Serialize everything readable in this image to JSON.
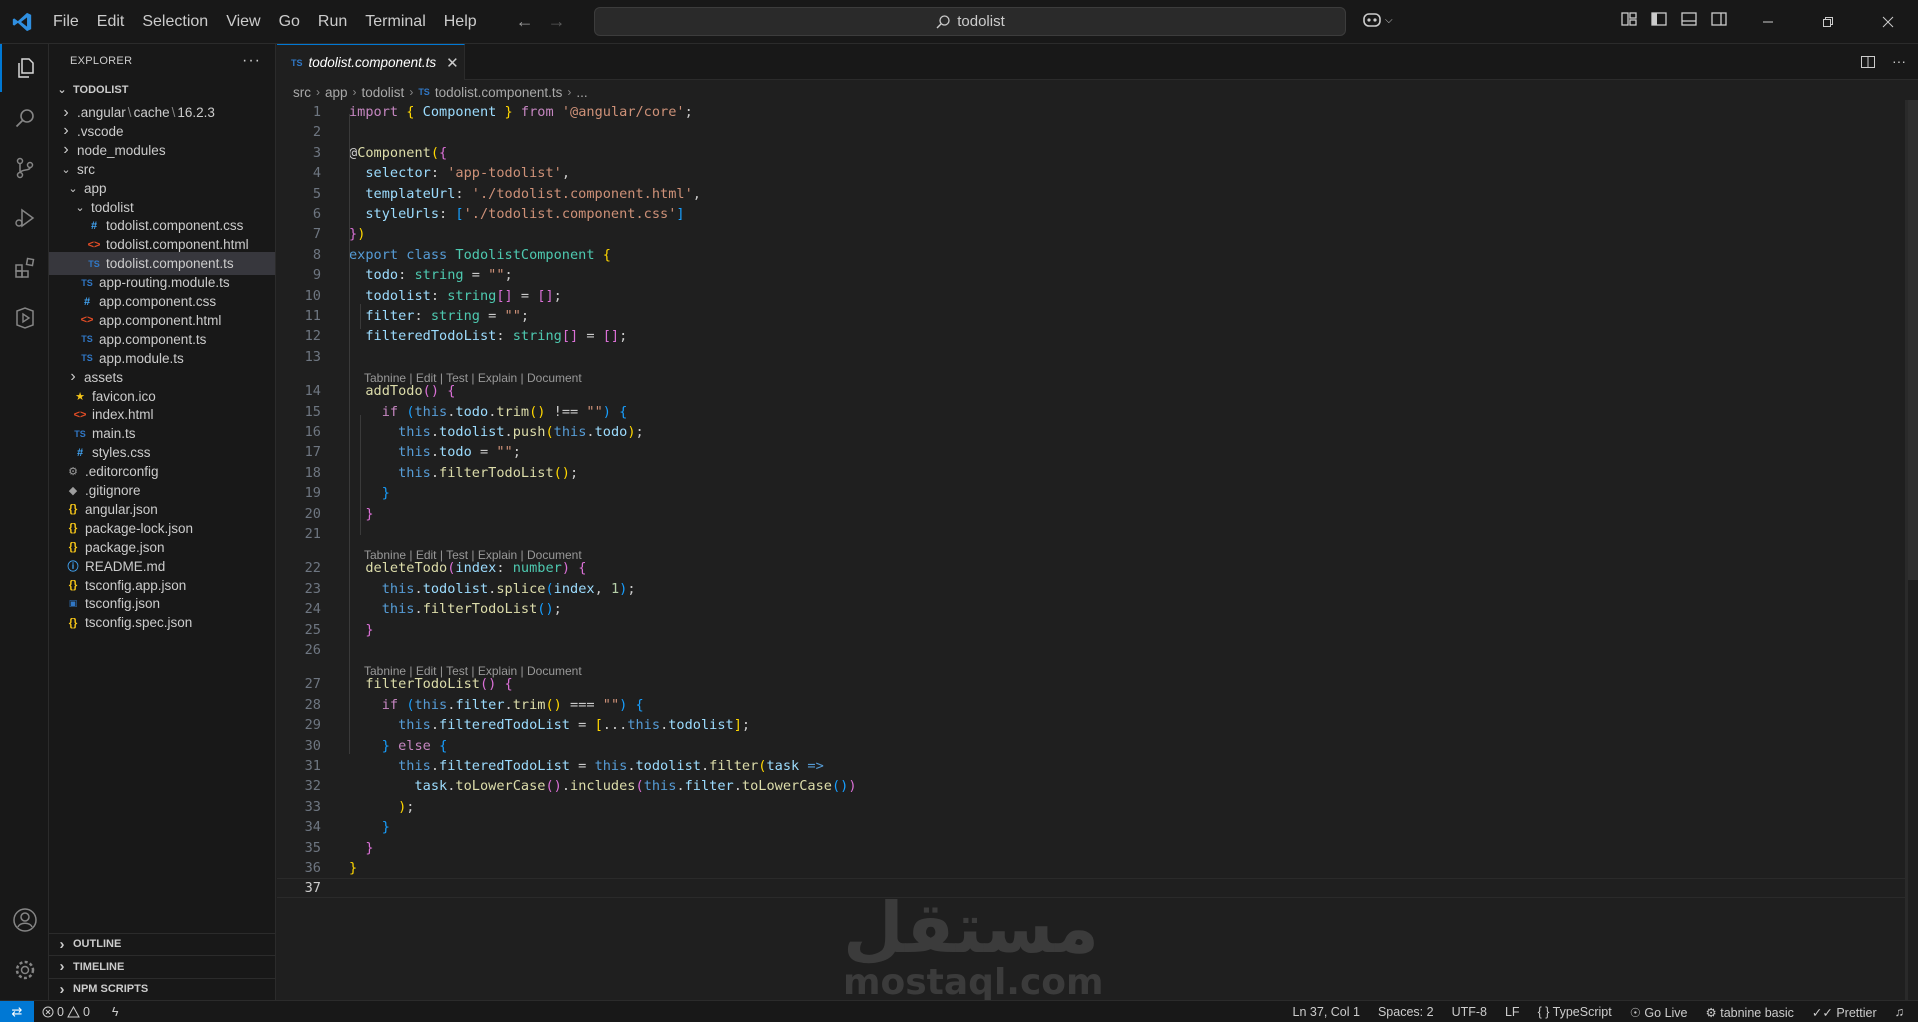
{
  "menu": [
    "File",
    "Edit",
    "Selection",
    "View",
    "Go",
    "Run",
    "Terminal",
    "Help"
  ],
  "search": {
    "text": "todolist"
  },
  "explorer": {
    "title": "EXPLORER",
    "root": "TODOLIST",
    "items": [
      {
        "label": "",
        "parts": [
          ".angular",
          "cache",
          "16.2.3"
        ],
        "depth": 0,
        "chevron": "right",
        "icon": ""
      },
      {
        "label": ".vscode",
        "depth": 0,
        "chevron": "right",
        "icon": ""
      },
      {
        "label": "node_modules",
        "depth": 0,
        "chevron": "right",
        "icon": ""
      },
      {
        "label": "src",
        "depth": 0,
        "chevron": "down",
        "icon": ""
      },
      {
        "label": "app",
        "depth": 1,
        "chevron": "down",
        "icon": ""
      },
      {
        "label": "todolist",
        "depth": 2,
        "chevron": "down",
        "icon": ""
      },
      {
        "label": "todolist.component.css",
        "depth": 3,
        "chevron": "",
        "icon": "css"
      },
      {
        "label": "todolist.component.html",
        "depth": 3,
        "chevron": "",
        "icon": "html"
      },
      {
        "label": "todolist.component.ts",
        "depth": 3,
        "chevron": "",
        "icon": "ts",
        "selected": true
      },
      {
        "label": "app-routing.module.ts",
        "depth": 2,
        "chevron": "",
        "icon": "ts"
      },
      {
        "label": "app.component.css",
        "depth": 2,
        "chevron": "",
        "icon": "css"
      },
      {
        "label": "app.component.html",
        "depth": 2,
        "chevron": "",
        "icon": "html"
      },
      {
        "label": "app.component.ts",
        "depth": 2,
        "chevron": "",
        "icon": "ts"
      },
      {
        "label": "app.module.ts",
        "depth": 2,
        "chevron": "",
        "icon": "ts"
      },
      {
        "label": "assets",
        "depth": 1,
        "chevron": "right",
        "icon": ""
      },
      {
        "label": "favicon.ico",
        "depth": 1,
        "chevron": "",
        "icon": "star"
      },
      {
        "label": "index.html",
        "depth": 1,
        "chevron": "",
        "icon": "html"
      },
      {
        "label": "main.ts",
        "depth": 1,
        "chevron": "",
        "icon": "ts"
      },
      {
        "label": "styles.css",
        "depth": 1,
        "chevron": "",
        "icon": "css"
      },
      {
        "label": ".editorconfig",
        "depth": 0,
        "chevron": "",
        "icon": "gear"
      },
      {
        "label": ".gitignore",
        "depth": 0,
        "chevron": "",
        "icon": "git"
      },
      {
        "label": "angular.json",
        "depth": 0,
        "chevron": "",
        "icon": "json"
      },
      {
        "label": "package-lock.json",
        "depth": 0,
        "chevron": "",
        "icon": "json"
      },
      {
        "label": "package.json",
        "depth": 0,
        "chevron": "",
        "icon": "json"
      },
      {
        "label": "README.md",
        "depth": 0,
        "chevron": "",
        "icon": "info"
      },
      {
        "label": "tsconfig.app.json",
        "depth": 0,
        "chevron": "",
        "icon": "json"
      },
      {
        "label": "tsconfig.json",
        "depth": 0,
        "chevron": "",
        "icon": "tsconfig"
      },
      {
        "label": "tsconfig.spec.json",
        "depth": 0,
        "chevron": "",
        "icon": "json"
      }
    ],
    "panels": [
      "OUTLINE",
      "TIMELINE",
      "NPM SCRIPTS"
    ]
  },
  "tab": {
    "label": "todolist.component.ts",
    "badge": "TS"
  },
  "breadcrumb": [
    "src",
    "app",
    "todolist",
    "todolist.component.ts",
    "..."
  ],
  "codelens": "Tabnine | Edit | Test | Explain | Document",
  "code_lines": [
    {
      "n": "1",
      "html": "<span class='k'>import</span> <span class='b1'>{</span> <span class='v'>Component</span> <span class='b1'>}</span> <span class='k'>from</span> <span class='s'>'@angular/core'</span>;"
    },
    {
      "n": "2",
      "html": ""
    },
    {
      "n": "3",
      "html": "@<span class='f'>Component</span><span class='b1'>(</span><span class='b2'>{</span>"
    },
    {
      "n": "4",
      "html": "  <span class='v'>selector</span>: <span class='s'>'app-todolist'</span>,"
    },
    {
      "n": "5",
      "html": "  <span class='v'>templateUrl</span>: <span class='s'>'./todolist.component.html'</span>,"
    },
    {
      "n": "6",
      "html": "  <span class='v'>styleUrls</span>: <span class='b3'>[</span><span class='s'>'./todolist.component.css'</span><span class='b3'>]</span>"
    },
    {
      "n": "7",
      "html": "<span class='b2'>}</span><span class='b1'>)</span>"
    },
    {
      "n": "8",
      "html": "<span class='kb'>export</span> <span class='kb'>class</span> <span class='t'>TodolistComponent</span> <span class='b1'>{</span>"
    },
    {
      "n": "9",
      "html": "  <span class='v'>todo</span>: <span class='t'>string</span> = <span class='s'>\"\"</span>;"
    },
    {
      "n": "10",
      "html": "  <span class='v'>todolist</span>: <span class='t'>string</span><span class='b2'>[]</span> = <span class='b2'>[]</span>;"
    },
    {
      "n": "11",
      "html": "  <span class='v'>filter</span>: <span class='t'>string</span> = <span class='s'>\"\"</span>;"
    },
    {
      "n": "12",
      "html": "  <span class='v'>filteredTodoList</span>: <span class='t'>string</span><span class='b2'>[]</span> = <span class='b2'>[]</span>;"
    },
    {
      "n": "13",
      "html": ""
    },
    {
      "n": "",
      "lens": true
    },
    {
      "n": "14",
      "html": "  <span class='f'>addTodo</span><span class='b2'>()</span> <span class='b2'>{</span>"
    },
    {
      "n": "15",
      "html": "    <span class='k'>if</span> <span class='b3'>(</span><span class='kb'>this</span>.<span class='v'>todo</span>.<span class='f'>trim</span><span class='b1'>()</span> !== <span class='s'>\"\"</span><span class='b3'>)</span> <span class='b3'>{</span>"
    },
    {
      "n": "16",
      "html": "      <span class='kb'>this</span>.<span class='v'>todolist</span>.<span class='f'>push</span><span class='b1'>(</span><span class='kb'>this</span>.<span class='v'>todo</span><span class='b1'>)</span>;"
    },
    {
      "n": "17",
      "html": "      <span class='kb'>this</span>.<span class='v'>todo</span> = <span class='s'>\"\"</span>;"
    },
    {
      "n": "18",
      "html": "      <span class='kb'>this</span>.<span class='f'>filterTodoList</span><span class='b1'>()</span>;"
    },
    {
      "n": "19",
      "html": "    <span class='b3'>}</span>"
    },
    {
      "n": "20",
      "html": "  <span class='b2'>}</span>"
    },
    {
      "n": "21",
      "html": ""
    },
    {
      "n": "",
      "lens": true
    },
    {
      "n": "22",
      "html": "  <span class='f'>deleteTodo</span><span class='b2'>(</span><span class='v'>index</span>: <span class='t'>number</span><span class='b2'>)</span> <span class='b2'>{</span>"
    },
    {
      "n": "23",
      "html": "    <span class='kb'>this</span>.<span class='v'>todolist</span>.<span class='f'>splice</span><span class='b3'>(</span><span class='v'>index</span>, <span class='n'>1</span><span class='b3'>)</span>;"
    },
    {
      "n": "24",
      "html": "    <span class='kb'>this</span>.<span class='f'>filterTodoList</span><span class='b3'>()</span>;"
    },
    {
      "n": "25",
      "html": "  <span class='b2'>}</span>"
    },
    {
      "n": "26",
      "html": ""
    },
    {
      "n": "",
      "lens": true
    },
    {
      "n": "27",
      "html": "  <span class='f'>filterTodoList</span><span class='b2'>()</span> <span class='b2'>{</span>"
    },
    {
      "n": "28",
      "html": "    <span class='k'>if</span> <span class='b3'>(</span><span class='kb'>this</span>.<span class='v'>filter</span>.<span class='f'>trim</span><span class='b1'>()</span> === <span class='s'>\"\"</span><span class='b3'>)</span> <span class='b3'>{</span>"
    },
    {
      "n": "29",
      "html": "      <span class='kb'>this</span>.<span class='v'>filteredTodoList</span> = <span class='b1'>[</span>...<span class='kb'>this</span>.<span class='v'>todolist</span><span class='b1'>]</span>;"
    },
    {
      "n": "30",
      "html": "    <span class='b3'>}</span> <span class='k'>else</span> <span class='b3'>{</span>"
    },
    {
      "n": "31",
      "html": "      <span class='kb'>this</span>.<span class='v'>filteredTodoList</span> = <span class='kb'>this</span>.<span class='v'>todolist</span>.<span class='f'>filter</span><span class='b1'>(</span><span class='v'>task</span> <span class='kb'>=&gt;</span>"
    },
    {
      "n": "32",
      "html": "        <span class='v'>task</span>.<span class='f'>toLowerCase</span><span class='b2'>()</span>.<span class='f'>includes</span><span class='b2'>(</span><span class='kb'>this</span>.<span class='v'>filter</span>.<span class='f'>toLowerCase</span><span class='b3'>()</span><span class='b2'>)</span>"
    },
    {
      "n": "33",
      "html": "      <span class='b1'>)</span>;"
    },
    {
      "n": "34",
      "html": "    <span class='b3'>}</span>"
    },
    {
      "n": "35",
      "html": "  <span class='b2'>}</span>"
    },
    {
      "n": "36",
      "html": "<span class='b1'>}</span>"
    },
    {
      "n": "37",
      "html": "",
      "current": true
    }
  ],
  "watermark": {
    "arabic": "مستقل",
    "latin": "mostaql.com"
  },
  "status": {
    "errors": "0",
    "warnings": "0",
    "position": "Ln 37, Col 1",
    "spaces": "Spaces: 2",
    "encoding": "UTF-8",
    "eol": "LF",
    "language": "TypeScript",
    "golive": "Go Live",
    "tabnine": "tabnine basic",
    "prettier": "Prettier"
  },
  "colors": {
    "accent": "#0078d4",
    "background": "#1f1f1f",
    "sidebar": "#181818"
  }
}
